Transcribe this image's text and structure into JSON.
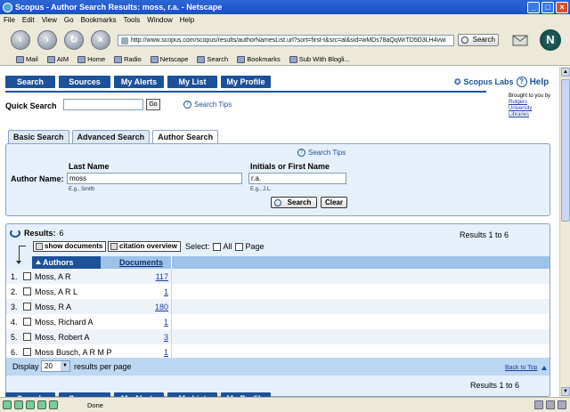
{
  "window": {
    "title": "Scopus - Author Search Results: moss, r.a. - Netscape"
  },
  "menu": [
    "File",
    "Edit",
    "View",
    "Go",
    "Bookmarks",
    "Tools",
    "Window",
    "Help"
  ],
  "browser": {
    "url": "http://www.scopus.com/scopus/results/authorNamesList.url?sort=first-t&src=al&sid=wMDs78aQqWrTD5D3LH4vwi",
    "search_label": "Search",
    "logo_letter": "N",
    "bookmarks": [
      "Mail",
      "AIM",
      "Home",
      "Radio",
      "Netscape",
      "Search",
      "Bookmarks",
      "Sub With Blogli..."
    ]
  },
  "nav": {
    "items": [
      "Search",
      "Sources",
      "My Alerts",
      "My List",
      "My Profile"
    ],
    "labs": "Scopus Labs",
    "help": "Help"
  },
  "brought_by": {
    "line1": "Brought to you by",
    "links": [
      "Rutgers",
      "University",
      "Libraries"
    ]
  },
  "quick_search": {
    "label": "Quick Search",
    "value": "",
    "go": "Go",
    "tips": "Search Tips"
  },
  "tabs": [
    "Basic Search",
    "Advanced Search",
    "Author Search"
  ],
  "author_form": {
    "tips": "Search Tips",
    "label_author": "Author Name:",
    "label_last": "Last Name",
    "label_initials": "Initials or First Name",
    "last_value": "moss",
    "initials_value": "r.a.",
    "eg_last": "E.g., Smith",
    "eg_initials": "E.g., J.L.",
    "search_btn": "Search",
    "clear_btn": "Clear"
  },
  "results": {
    "label": "Results:",
    "count": "6",
    "range": "Results 1 to 6",
    "show_documents": "show documents",
    "citation_overview": "citation overview",
    "select_label": "Select:",
    "select_all": "All",
    "select_page": "Page",
    "col_authors": "Authors",
    "col_documents": "Documents",
    "rows": [
      {
        "num": "1.",
        "name": "Moss, A R",
        "docs": "117"
      },
      {
        "num": "2.",
        "name": "Moss, A R L",
        "docs": "1"
      },
      {
        "num": "3.",
        "name": "Moss, R A",
        "docs": "180"
      },
      {
        "num": "4.",
        "name": "Moss, Richard A",
        "docs": "1"
      },
      {
        "num": "5.",
        "name": "Moss, Robert A",
        "docs": "3"
      },
      {
        "num": "6.",
        "name": "Moss Busch, A R M P",
        "docs": "1"
      }
    ],
    "display_label": "Display",
    "per_page_value": "20",
    "per_page_suffix": "results per page",
    "back_to_top": "Back to Top",
    "range_bottom": "Results 1 to 6"
  },
  "status": {
    "text": "Done"
  }
}
